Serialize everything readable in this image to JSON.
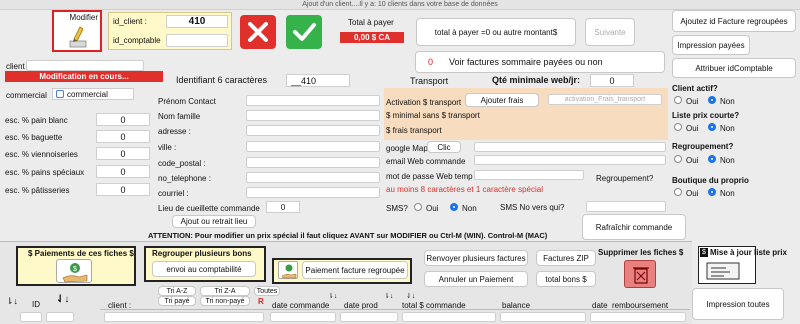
{
  "window_title": "Ajout d'un client....Il y a: 10 clients dans votre base de données",
  "modifier_label": "Modifier",
  "id_client_label": "id_client :",
  "id_client_value": "410",
  "id_comptable_label": "id_comptable",
  "total_label": "Total à payer",
  "total_value": "0,00 $ CA",
  "total_msg": "total à payer =0 ou  autre montant$",
  "suivante": "Suivante",
  "voir_count": "0",
  "voir_label": "Voir factures sommaire payées ou non",
  "right_buttons": [
    "Ajoutez id Facture regroupées",
    "Impression payées",
    "Attribuer idComptable"
  ],
  "client_label": "client",
  "mode_banner": "Modification en cours...",
  "identifiant_label": "Identifiant 6 caractères",
  "identifiant_value": "__410",
  "transport_label": "Transport",
  "qte_label": "Qté minimale web/jr:",
  "qte_value": "0",
  "commercial_label": "commercial",
  "commercial_checkbox": "commercial",
  "esc": [
    {
      "label": "esc. % pain blanc",
      "value": "0"
    },
    {
      "label": "esc. % baguette",
      "value": "0"
    },
    {
      "label": "esc. % viennoiseries",
      "value": "0"
    },
    {
      "label": "esc. % pains spéciaux",
      "value": "0"
    },
    {
      "label": "esc. % pâtisseries",
      "value": "0"
    }
  ],
  "fields": [
    "Prénom Contact",
    "Nom famille",
    "adresse :",
    "ville :",
    "code_postal :",
    "no_telephone :",
    "courriel :"
  ],
  "cueillette_label": "Lieu de cueillette commande",
  "cueillette_value": "0",
  "ajout_retrait": "Ajout ou retrait lieu",
  "activation_label": "Activation $ transport",
  "ajouter_frais": "Ajouter frais",
  "activation_placeholder": "activation_Frais_transport",
  "minimal_label": "$ minimal sans $ transport",
  "frais_label": "$ frais transport",
  "google_label": "google Map",
  "clic": "Clic",
  "email_cmd": "email Web commande",
  "mot_passe": "mot de passe Web temp",
  "regroupement_label": "Regroupement?",
  "warning_red": "au moins 8 caractères et 1 caractère spécial",
  "sms_label": "SMS?",
  "oui": "Oui",
  "non": "Non",
  "sms_vers": "SMS No vers qui?",
  "rafraichir": "Rafraîchir commande",
  "client_actif": "Client actif?",
  "liste_prix": "Liste prix courte?",
  "regroupement_q": "Regroupement?",
  "boutique": "Boutique du proprio",
  "attention": "ATTENTION: Pour modifier un prix spécial il faut cliquez AVANT sur MODIFIER ou Ctrl-M (WIN). Control-M (MAC)",
  "paiements_title": "$ Paiements de ces fiches $",
  "regrouper_title": "Regrouper plusieurs bons",
  "envoi_compta": "envoi au comptabilité",
  "paiement_regroupee": "Paiement facture regroupée",
  "renvoyer": "Renvoyer plusieurs factures",
  "factures_zip": "Factures ZIP",
  "annuler": "Annuler un Paiement",
  "total_bons": "total bons $",
  "supprimer": "Supprimer les fiches $",
  "mise_a_jour": "Mise à jour liste prix",
  "impression_toutes": "Impression toutes",
  "sort_buttons": [
    "Tri A-Z",
    "Tri Z-A",
    "Toutes",
    "Tri payé",
    "Tri non-payé",
    "R"
  ],
  "columns": [
    "ID",
    "client :",
    "date commande",
    "date prod",
    "total $ commande",
    "balance",
    "date_remboursement"
  ]
}
